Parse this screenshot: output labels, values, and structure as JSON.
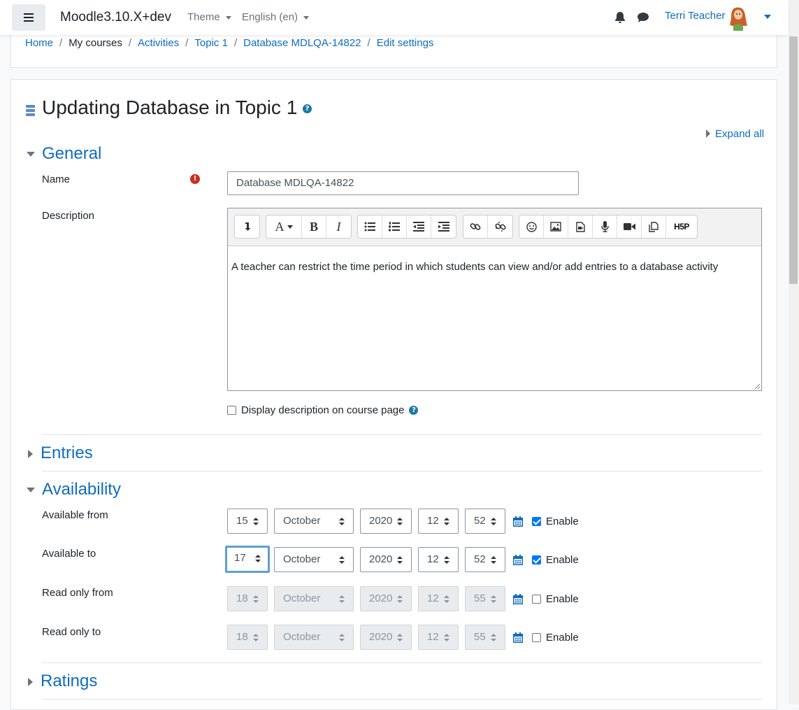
{
  "navbar": {
    "brand": "Moodle3.10.X+dev",
    "theme_menu": "Theme",
    "language_menu": "English (en)",
    "user_name": "Terri Teacher"
  },
  "breadcrumb": [
    "Home",
    "My courses",
    "Activities",
    "Topic 1",
    "Database MDLQA-14822",
    "Edit settings"
  ],
  "page": {
    "title": "Updating Database in Topic 1",
    "expand_all": "Expand all"
  },
  "sections": {
    "general": "General",
    "entries": "Entries",
    "availability": "Availability",
    "ratings": "Ratings"
  },
  "general": {
    "name_label": "Name",
    "name_value": "Database MDLQA-14822",
    "description_label": "Description",
    "description_text": "A teacher can restrict the time period in which students can view and/or add entries to a database activity",
    "display_description_label": "Display description on course page",
    "display_description_checked": false
  },
  "editor_toolbar": {
    "font_button": "A",
    "bold": "B",
    "italic": "I",
    "hp": "H5P"
  },
  "availability": {
    "enable_label": "Enable",
    "rows": [
      {
        "label": "Available from",
        "day": "15",
        "month": "October",
        "year": "2020",
        "hour": "12",
        "minute": "52",
        "enabled": true
      },
      {
        "label": "Available to",
        "day": "17",
        "month": "October",
        "year": "2020",
        "hour": "12",
        "minute": "52",
        "enabled": true
      },
      {
        "label": "Read only from",
        "day": "18",
        "month": "October",
        "year": "2020",
        "hour": "12",
        "minute": "55",
        "enabled": false
      },
      {
        "label": "Read only to",
        "day": "18",
        "month": "October",
        "year": "2020",
        "hour": "12",
        "minute": "55",
        "enabled": false
      }
    ]
  },
  "colors": {
    "link": "#0f6cbf",
    "required": "#ca3120",
    "help": "#1a7aa4",
    "focus": "#5c9fd6"
  }
}
